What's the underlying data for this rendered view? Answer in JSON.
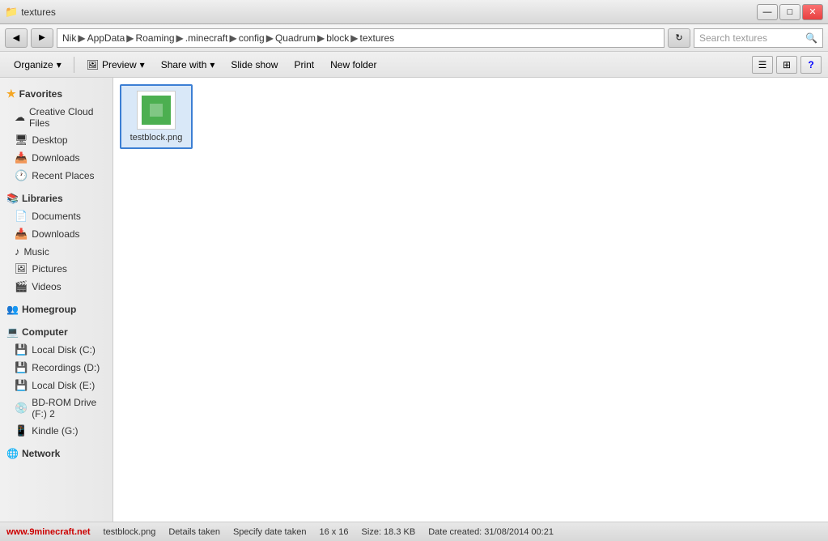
{
  "titlebar": {
    "buttons": {
      "minimize": "—",
      "maximize": "□",
      "close": "✕"
    }
  },
  "addressbar": {
    "back_btn": "◀",
    "forward_btn": "▶",
    "path_parts": [
      "Nik",
      "AppData",
      "Roaming",
      ".minecraft",
      "config",
      "Quadrum",
      "block",
      "textures"
    ],
    "refresh_btn": "↻",
    "search_placeholder": "Search textures"
  },
  "toolbar": {
    "organize": "Organize",
    "organize_arrow": "▾",
    "preview": "Preview",
    "preview_arrow": "▾",
    "share_with": "Share with",
    "share_arrow": "▾",
    "slideshow": "Slide show",
    "print": "Print",
    "new_folder": "New folder"
  },
  "sidebar": {
    "favorites_label": "Favorites",
    "favorites_items": [
      {
        "label": "Creative Cloud Files",
        "icon": "☁"
      },
      {
        "label": "Desktop",
        "icon": "🖥"
      },
      {
        "label": "Downloads",
        "icon": "📥"
      },
      {
        "label": "Recent Places",
        "icon": "🕐"
      }
    ],
    "libraries_label": "Libraries",
    "libraries_items": [
      {
        "label": "Documents",
        "icon": "📄"
      },
      {
        "label": "Downloads",
        "icon": "📥"
      },
      {
        "label": "Music",
        "icon": "♪"
      },
      {
        "label": "Pictures",
        "icon": "🖼"
      },
      {
        "label": "Videos",
        "icon": "🎬"
      }
    ],
    "homegroup_label": "Homegroup",
    "computer_label": "Computer",
    "computer_items": [
      {
        "label": "Local Disk (C:)",
        "icon": "💾"
      },
      {
        "label": "Recordings (D:)",
        "icon": "💾"
      },
      {
        "label": "Local Disk (E:)",
        "icon": "💾"
      },
      {
        "label": "BD-ROM Drive (F:) 2",
        "icon": "💿"
      },
      {
        "label": "Kindle (G:)",
        "icon": "📱"
      }
    ],
    "network_label": "Network"
  },
  "file": {
    "name": "testblock.png",
    "icon_color": "#4caf50"
  },
  "statusbar": {
    "watermark": "www.9minecraft.net",
    "name": "testblock.png",
    "details": "Details taken",
    "date_label": "Specify date taken",
    "dimensions": "16 x 16",
    "size_label": "Size: 18.3 KB",
    "date_created": "Date created: 31/08/2014 00:21"
  }
}
